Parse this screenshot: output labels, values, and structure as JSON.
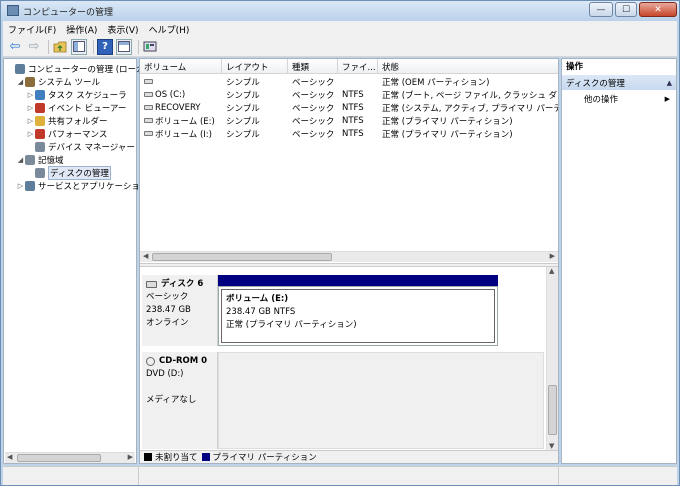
{
  "window": {
    "title": "コンピューターの管理",
    "close_glyph": "✕",
    "min_glyph": "—",
    "max_glyph": "☐"
  },
  "menu": [
    "ファイル(F)",
    "操作(A)",
    "表示(V)",
    "ヘルプ(H)"
  ],
  "tree": [
    {
      "label": "コンピューターの管理 (ローカ",
      "level": 0,
      "expander": "",
      "icon": "computer-icon",
      "color": "#5e7d9b"
    },
    {
      "label": "システム ツール",
      "level": 1,
      "expander": "◢",
      "icon": "tools-icon",
      "color": "#8b6d3b"
    },
    {
      "label": "タスク スケジューラ",
      "level": 2,
      "expander": "▷",
      "icon": "clock-icon",
      "color": "#3f7fbf"
    },
    {
      "label": "イベント ビューアー",
      "level": 2,
      "expander": "▷",
      "icon": "event-viewer-icon",
      "color": "#c0392b"
    },
    {
      "label": "共有フォルダー",
      "level": 2,
      "expander": "▷",
      "icon": "shared-folder-icon",
      "color": "#e0b13a"
    },
    {
      "label": "パフォーマンス",
      "level": 2,
      "expander": "▷",
      "icon": "performance-icon",
      "color": "#c0392b"
    },
    {
      "label": "デバイス マネージャー",
      "level": 2,
      "expander": "",
      "icon": "device-manager-icon",
      "color": "#7a8a9a"
    },
    {
      "label": "記憶域",
      "level": 1,
      "expander": "◢",
      "icon": "storage-icon",
      "color": "#7a8a9a"
    },
    {
      "label": "ディスクの管理",
      "level": 2,
      "expander": "",
      "icon": "disk-management-icon",
      "color": "#7a8a9a",
      "selected": true
    },
    {
      "label": "サービスとアプリケーショ",
      "level": 1,
      "expander": "▷",
      "icon": "services-icon",
      "color": "#5e7d9b"
    }
  ],
  "volume_table": {
    "columns": [
      "ボリューム",
      "レイアウト",
      "種類",
      "ファイ...",
      "状態"
    ],
    "rows": [
      [
        "",
        "シンプル",
        "ベーシック",
        "",
        "正常 (OEM パーティション)"
      ],
      [
        "OS (C:)",
        "シンプル",
        "ベーシック",
        "NTFS",
        "正常 (ブート, ページ ファイル, クラッシュ ダ"
      ],
      [
        "RECOVERY",
        "シンプル",
        "ベーシック",
        "NTFS",
        "正常 (システム, アクティブ, プライマリ パーテ"
      ],
      [
        "ボリューム (E:)",
        "シンプル",
        "ベーシック",
        "NTFS",
        "正常 (プライマリ パーティション)"
      ],
      [
        "ボリューム (I:)",
        "シンプル",
        "ベーシック",
        "NTFS",
        "正常 (プライマリ パーティション)"
      ]
    ]
  },
  "disks": [
    {
      "name": "ディスク 6",
      "type": "ベーシック",
      "size": "238.47 GB",
      "status": "オンライン",
      "partition": {
        "name": "ボリューム (E:)",
        "size_fs": "238.47 GB NTFS",
        "status": "正常 (プライマリ パーティション)"
      }
    },
    {
      "name": "CD-ROM 0",
      "type": "DVD (D:)",
      "status": "メディアなし"
    }
  ],
  "legend": [
    {
      "label": "未割り当て",
      "color": "#000000"
    },
    {
      "label": "プライマリ パーティション",
      "color": "#000080"
    }
  ],
  "actions": {
    "title": "操作",
    "section": "ディスクの管理",
    "section_glyph": "▲",
    "item": "他の操作",
    "item_glyph": "▶"
  }
}
